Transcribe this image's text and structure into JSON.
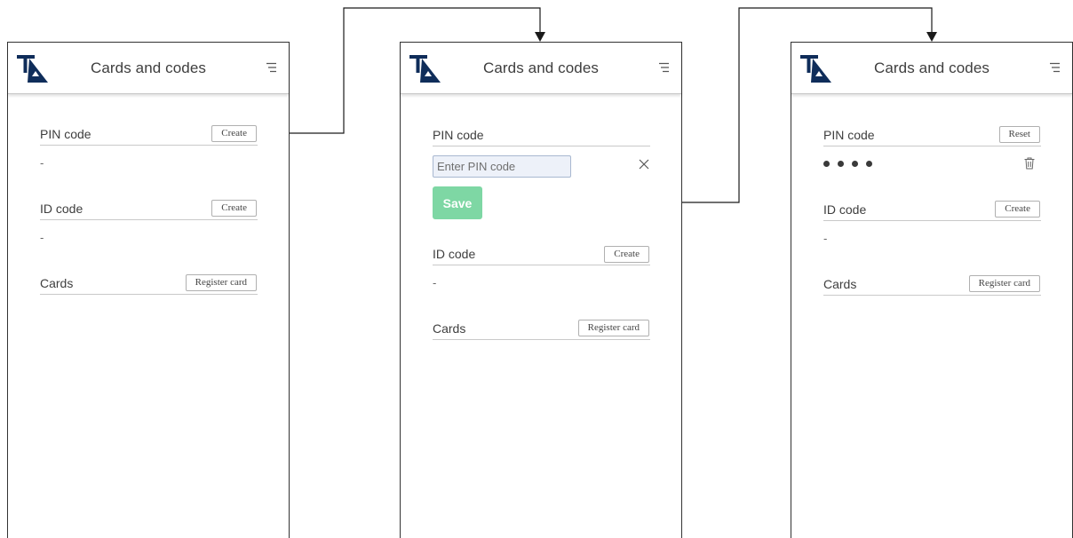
{
  "screens": [
    {
      "title": "Cards and codes",
      "pin": {
        "label": "PIN code",
        "button": "Create",
        "value": "-"
      },
      "id": {
        "label": "ID code",
        "button": "Create",
        "value": "-"
      },
      "cards": {
        "label": "Cards",
        "button": "Register card"
      }
    },
    {
      "title": "Cards and codes",
      "pin": {
        "label": "PIN code",
        "placeholder": "Enter PIN code",
        "save": "Save"
      },
      "id": {
        "label": "ID code",
        "button": "Create",
        "value": "-"
      },
      "cards": {
        "label": "Cards",
        "button": "Register card"
      }
    },
    {
      "title": "Cards and codes",
      "pin": {
        "label": "PIN code",
        "button": "Reset",
        "masked_length": 4
      },
      "id": {
        "label": "ID code",
        "button": "Create",
        "value": "-"
      },
      "cards": {
        "label": "Cards",
        "button": "Register card"
      }
    }
  ],
  "colors": {
    "logo_navy": "#0f2d5a",
    "save_green": "#7ed7a4",
    "input_bg": "#edf1f9",
    "connector": "#1a1a1a"
  },
  "icons": [
    "logo-icon",
    "menu-icon",
    "close-icon",
    "trash-icon",
    "connector-dot",
    "connector-arrow"
  ]
}
